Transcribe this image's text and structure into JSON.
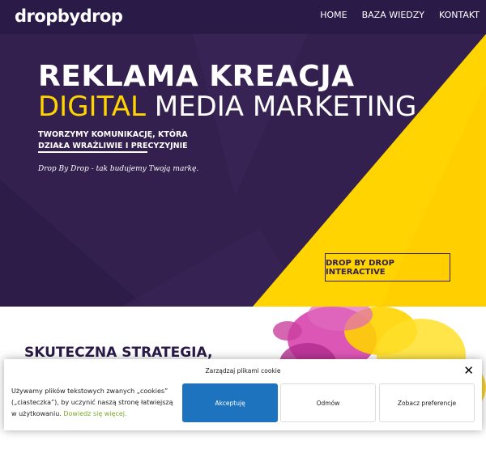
{
  "header": {
    "logo_text": "dropbydrop",
    "nav": [
      "HOME",
      "BAZA WIEDZY",
      "KONTAKT"
    ]
  },
  "hero": {
    "line1": "REKLAMA KREACJA",
    "line2_accent": "DIGITAL",
    "line2_rest": "MEDIA MARKETING",
    "sub_line1": "TWORZYMY KOMUNIKACJĘ, KTÓRA",
    "sub_line2": "DZIAŁA WRAŻLIWIE I PRECYZYJNIE",
    "tagline": "Drop By Drop - tak budujemy Twoją markę.",
    "cta_label": "DROP BY DROP INTERACTIVE"
  },
  "section": {
    "heading": "SKUTECZNA STRATEGIA,"
  },
  "cookie": {
    "title": "Zarządzaj plikami cookie",
    "text": "Używamy plików tekstowych zwanych „cookies” („ciasteczka”), by uczynić naszą stronę łatwiejszą w użytkowaniu.",
    "link": "Dowiedz się więcej.",
    "accept_label": "Akceptuję",
    "deny_label": "Odmów",
    "prefs_label": "Zobacz preferencje",
    "close_symbol": "✕"
  },
  "colors": {
    "header_bg": "#2a1a47",
    "hero_purple": "#33204f",
    "accent_yellow": "#ffd400",
    "accept_blue": "#1e73be",
    "link_green": "#7aa82a"
  }
}
